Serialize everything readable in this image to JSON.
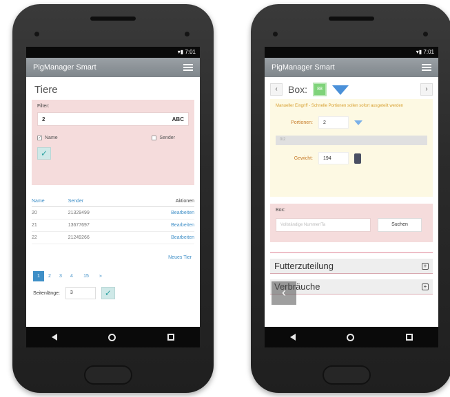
{
  "status": {
    "time": "7:01"
  },
  "app": {
    "title": "PigManager Smart"
  },
  "left": {
    "heading": "Tiere",
    "filter": {
      "label": "Filter:",
      "value": "2",
      "mode_label": "ABC",
      "options": [
        {
          "label": "Name",
          "checked": true
        },
        {
          "label": "Sender",
          "checked": false
        }
      ]
    },
    "table": {
      "headers": {
        "name": "Name",
        "sender": "Sender",
        "actions": "Aktionen"
      },
      "rows": [
        {
          "name": "20",
          "sender": "21329499",
          "action": "Bearbeiten"
        },
        {
          "name": "21",
          "sender": "13677697",
          "action": "Bearbeiten"
        },
        {
          "name": "22",
          "sender": "21249266",
          "action": "Bearbeiten"
        }
      ]
    },
    "new_animal_link": "Neues Tier",
    "pagination": [
      "1",
      "2",
      "3",
      "4",
      "15",
      "»"
    ],
    "page_size": {
      "label": "Seitenlänge:",
      "value": "3"
    }
  },
  "right": {
    "box_label": "Box:",
    "green_badge": "88",
    "warning": "Manueller Eingriff - Schnelle Portionen sollen sofort ausgeteilt werden",
    "portion": {
      "label": "Portionen:",
      "value": "2"
    },
    "progress_text": "0/2",
    "weight": {
      "label": "Gewicht:",
      "value": "194"
    },
    "box_search": {
      "label": "Box:",
      "placeholder": "Vollständige Nummer/Ta",
      "button": "Suchen"
    },
    "sections": [
      "Futterzuteilung",
      "Verbräuche"
    ]
  },
  "icons": {
    "checkmark": "✓",
    "back_arrow": "‹",
    "forward_arrow": "›",
    "plus": "+"
  }
}
